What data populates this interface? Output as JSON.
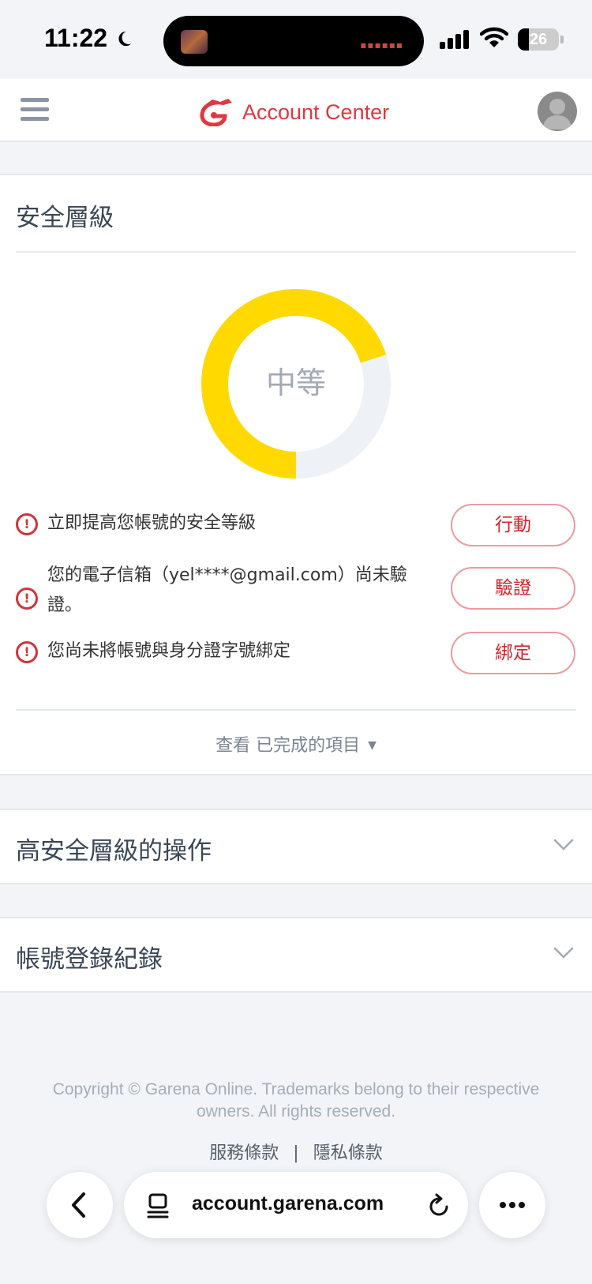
{
  "status_bar": {
    "time": "11:22",
    "battery": "26"
  },
  "header": {
    "brand": "Account Center"
  },
  "security": {
    "title": "安全層級",
    "level_label": "中等",
    "level_progress": 0.7,
    "accent_color": "#FFD900",
    "tasks": [
      {
        "text": "立即提高您帳號的安全等級",
        "button": "行動"
      },
      {
        "text": "您的電子信箱（yel****@gmail.com）尚未驗證。",
        "button": "驗證"
      },
      {
        "text": "您尚未將帳號與身分證字號綁定",
        "button": "綁定"
      }
    ],
    "view_completed": "查看 已完成的項目"
  },
  "sections": [
    {
      "title": "高安全層級的操作"
    },
    {
      "title": "帳號登錄紀錄"
    }
  ],
  "footer": {
    "copyright": "Copyright © Garena Online. Trademarks belong to their respective owners. All rights reserved.",
    "links": [
      "服務條款",
      "隱私條款"
    ],
    "separator": "|"
  },
  "browser": {
    "url": "account.garena.com"
  }
}
